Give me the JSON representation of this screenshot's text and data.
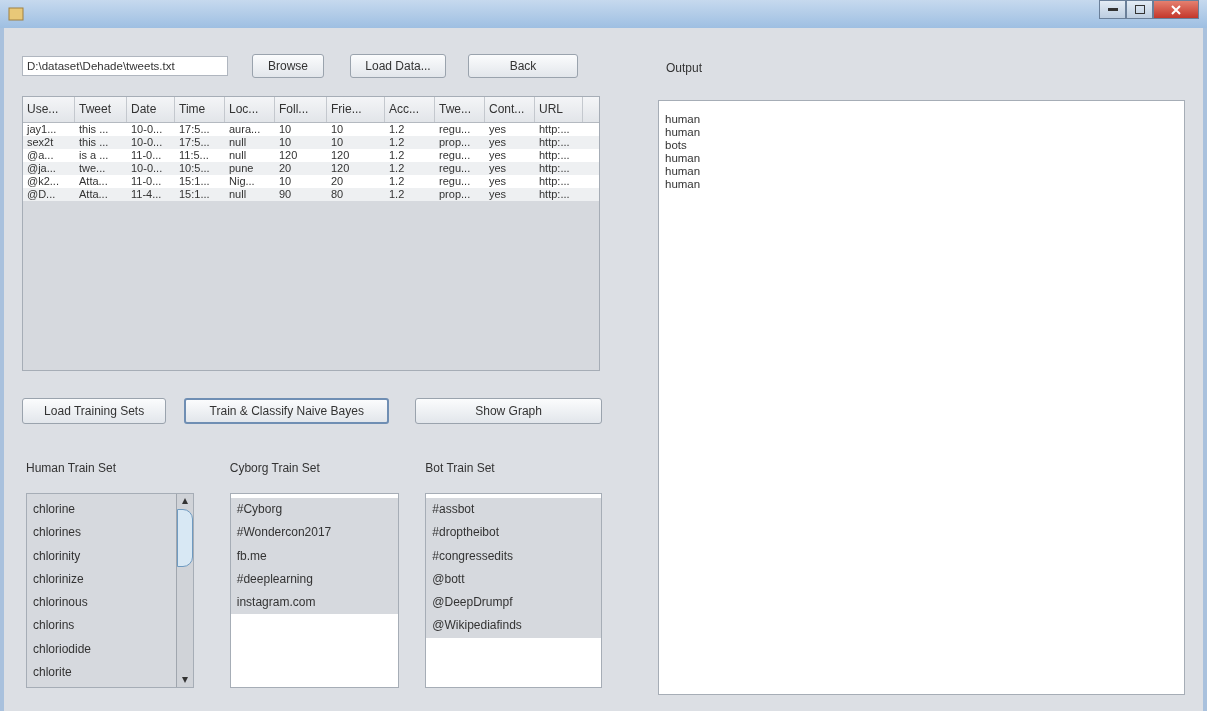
{
  "file_path": "D:\\dataset\\Dehade\\tweets.txt",
  "top_buttons": [
    "Browse",
    "Load Data...",
    "Back"
  ],
  "table": {
    "columns": [
      "Use...",
      "Tweet",
      "Date",
      "Time",
      "Loc...",
      "Foll...",
      "Frie...",
      "Acc...",
      "Twe...",
      "Cont...",
      "URL"
    ],
    "rows": [
      [
        "jay1...",
        "this ...",
        "10-0...",
        "17:5...",
        "aura...",
        "10",
        "10",
        "1.2",
        "regu...",
        "yes",
        "http:..."
      ],
      [
        "sex2t",
        "this ...",
        "10-0...",
        "17:5...",
        "null",
        "10",
        "10",
        "1.2",
        "prop...",
        "yes",
        "http:..."
      ],
      [
        "@a...",
        "is a ...",
        "11-0...",
        "11:5...",
        "null",
        "120",
        "120",
        "1.2",
        "regu...",
        "yes",
        "http:..."
      ],
      [
        "@ja...",
        "twe...",
        "10-0...",
        "10:5...",
        "pune",
        "20",
        "120",
        "1.2",
        "regu...",
        "yes",
        "http:..."
      ],
      [
        "@k2...",
        "Atta...",
        "11-0...",
        "15:1...",
        "Nig...",
        "10",
        "20",
        "1.2",
        "regu...",
        "yes",
        "http:..."
      ],
      [
        "@D...",
        "Atta...",
        "11-4...",
        "15:1...",
        "null",
        "90",
        "80",
        "1.2",
        "prop...",
        "yes",
        "http:..."
      ]
    ]
  },
  "action_buttons": [
    {
      "label": "Load Training Sets",
      "focused": false
    },
    {
      "label": "Train & Classify Naive Bayes",
      "focused": true
    },
    {
      "label": "Show Graph",
      "focused": false
    }
  ],
  "train_sets": [
    {
      "title": "Human Train Set",
      "scrollable": true,
      "items": [
        "chlorine",
        "chlorines",
        "chlorinity",
        "chlorinize",
        "chlorinous",
        "chlorins",
        "chloriodide",
        "chlorite"
      ]
    },
    {
      "title": "Cyborg Train Set",
      "scrollable": false,
      "items": [
        "#Cyborg",
        "#Wondercon2017",
        "fb.me",
        "#deeplearning",
        "instagram.com"
      ]
    },
    {
      "title": "Bot Train Set",
      "scrollable": false,
      "items": [
        "#assbot",
        "#droptheibot",
        "#congressedits",
        "@bott",
        "@DeepDrumpf",
        "@Wikipediafinds"
      ]
    }
  ],
  "output": {
    "label": "Output",
    "lines": [
      "human",
      "human",
      "bots",
      "human",
      "human",
      "human"
    ]
  }
}
